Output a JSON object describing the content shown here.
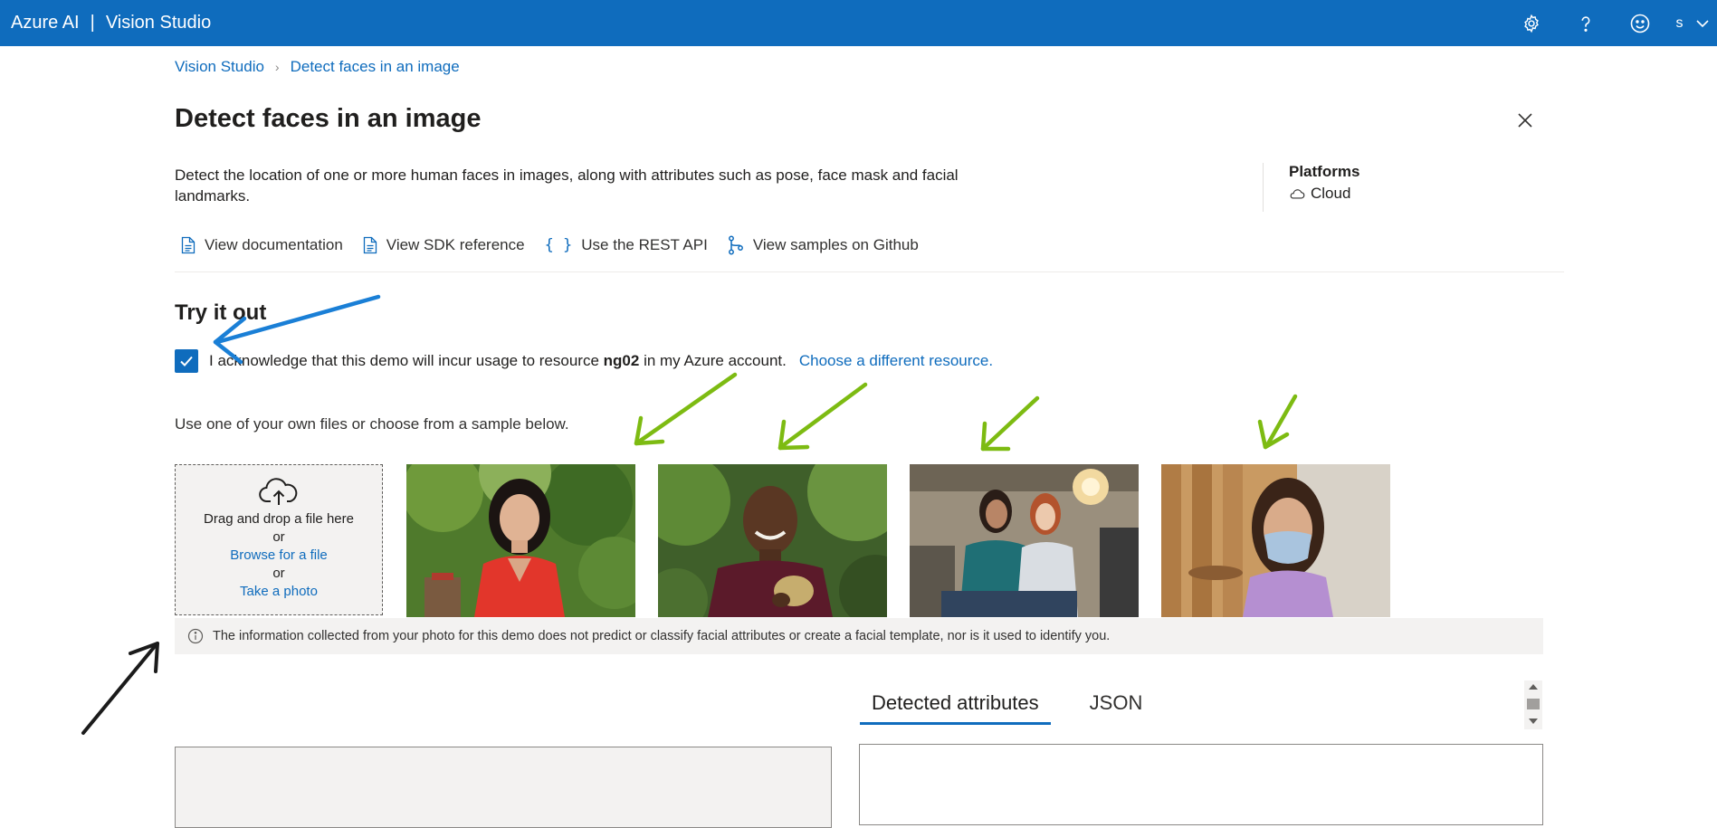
{
  "header": {
    "brand": "Azure AI",
    "separator": "|",
    "product": "Vision Studio",
    "icons": [
      "gear-icon",
      "help-icon",
      "feedback-smiley-icon"
    ],
    "user_initial": "s",
    "colors": {
      "bar": "#0f6cbd",
      "text": "#ffffff"
    }
  },
  "breadcrumb": {
    "home": "Vision Studio",
    "current": "Detect faces in an image"
  },
  "page": {
    "title": "Detect faces in an image",
    "description": "Detect the location of one or more human faces in images, along with attributes such as pose, face mask and facial landmarks."
  },
  "platforms": {
    "title": "Platforms",
    "value": "Cloud"
  },
  "links": {
    "documentation": "View documentation",
    "sdk": "View SDK reference",
    "rest": "Use the REST API",
    "github": "View samples on Github"
  },
  "try_it": {
    "title": "Try it out",
    "ack_prefix": "I acknowledge that this demo will incur usage to resource",
    "resource": "ng02",
    "ack_suffix": "in my Azure account.",
    "choose_link": "Choose a different resource.",
    "checked": true
  },
  "upload": {
    "instructions": "Use one of your own files or choose from a sample below.",
    "drag": "Drag and drop a file here",
    "or1": "or",
    "browse": "Browse for a file",
    "or2": "or",
    "photo": "Take a photo"
  },
  "info": {
    "text": "The information collected from your photo for this demo does not predict or classify facial attributes or create a facial template, nor is it used to identify you."
  },
  "results": {
    "tabs": [
      "Detected attributes",
      "JSON"
    ],
    "active_tab": "Detected attributes"
  },
  "colors": {
    "accent": "#0f6cbd",
    "panel": "#f3f2f1",
    "arrow_blue": "#1a7fd6",
    "arrow_green": "#7dbb12",
    "arrow_black": "#1b1b1b"
  }
}
